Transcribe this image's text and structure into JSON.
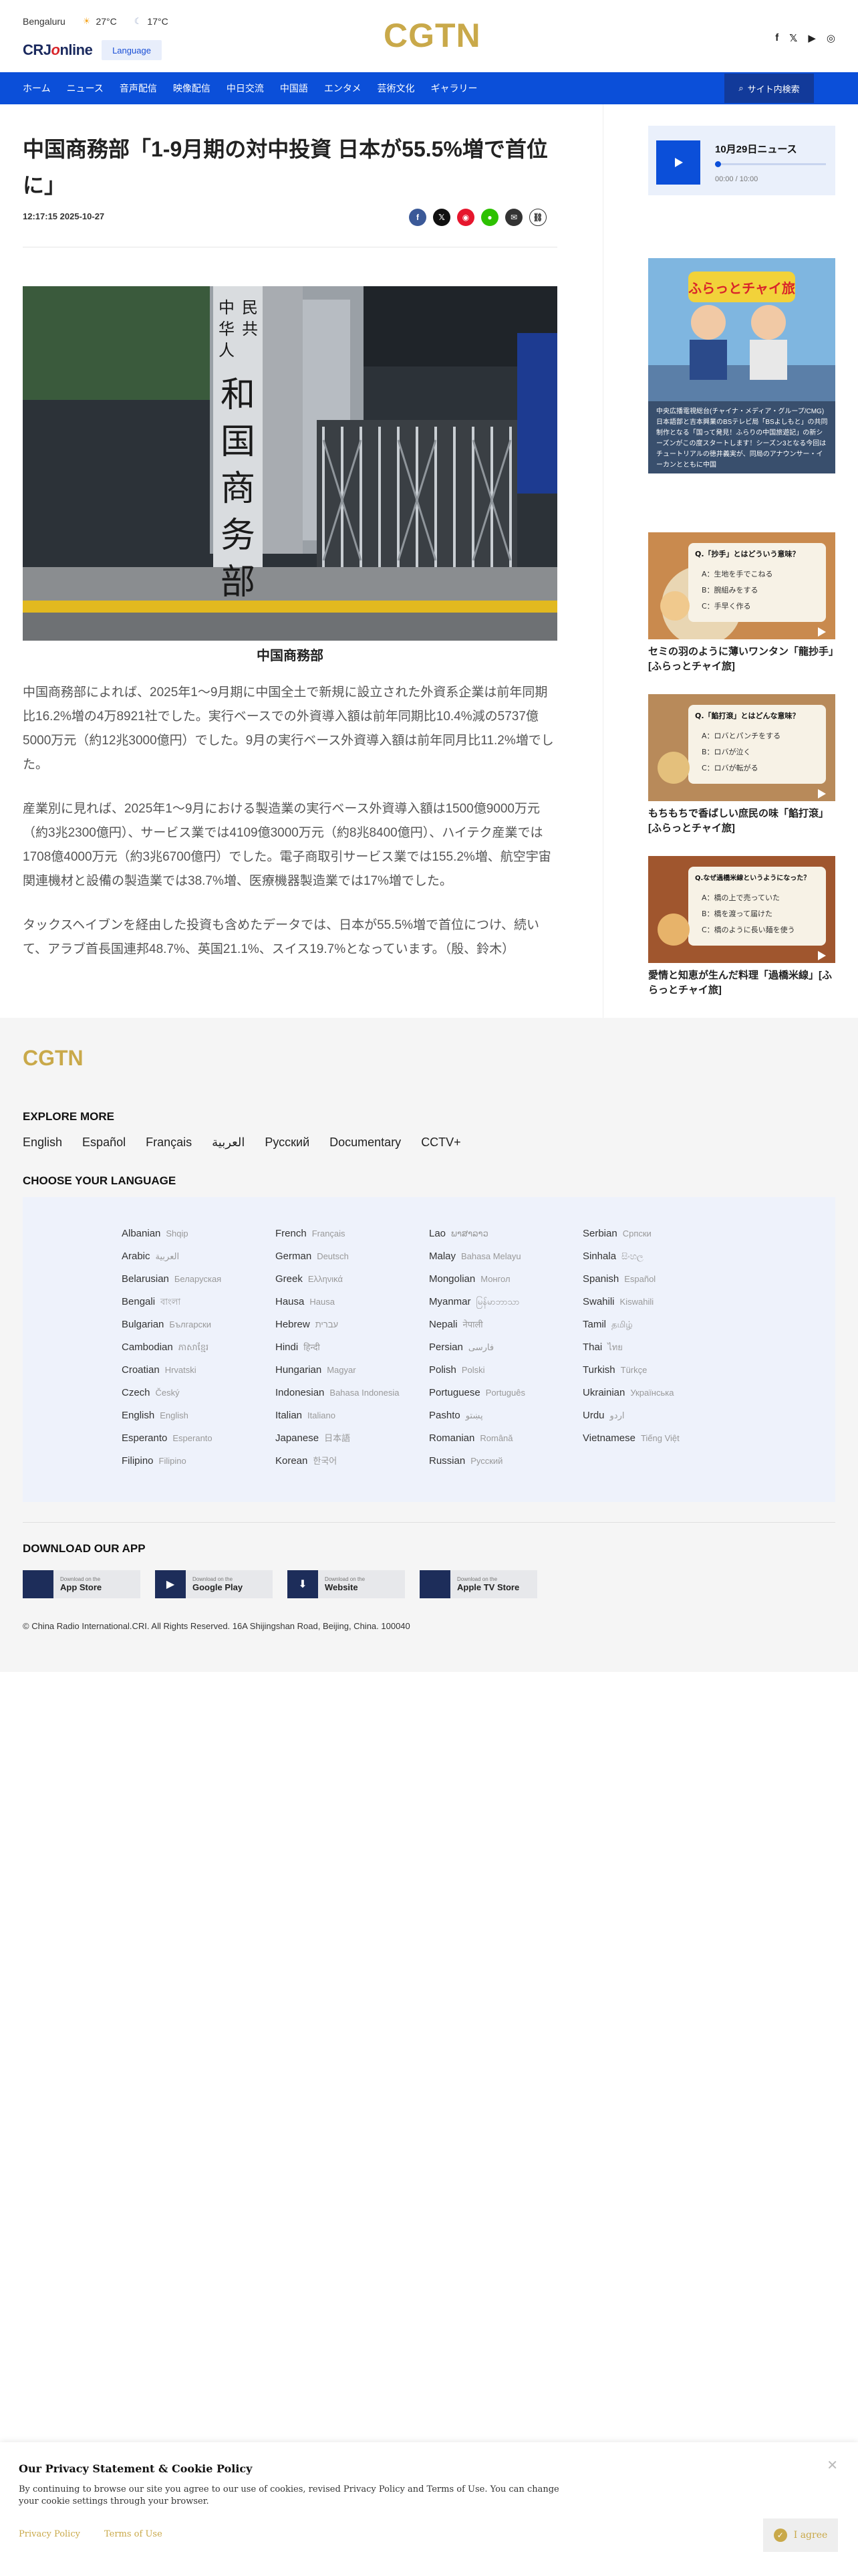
{
  "header": {
    "city": "Bengaluru",
    "temp_high": "27°C",
    "temp_low": "17°C",
    "crj_logo_a": "CRJ",
    "crj_logo_o": "o",
    "crj_logo_b": "nline",
    "language_label": "Language",
    "logo": "CGTN",
    "social": [
      "f",
      "𝕏",
      "▶",
      "◎"
    ]
  },
  "nav": {
    "items": [
      "ホーム",
      "ニュース",
      "音声配信",
      "映像配信",
      "中日交流",
      "中国語",
      "エンタメ",
      "芸術文化",
      "ギャラリー"
    ],
    "search_label": "サイト内検索"
  },
  "article": {
    "title": "中国商務部「1-9月期の対中投資 日本が55.5%増で首位に」",
    "datetime": "12:17:15 2025-10-27",
    "caption": "中国商務部",
    "sign_text": "中华人民共和国商务部",
    "paragraphs": [
      "中国商務部によれば、2025年1〜9月期に中国全土で新規に設立された外資系企業は前年同期比16.2%増の4万8921社でした。実行ベースでの外資導入額は前年同期比10.4%減の5737億5000万元（約12兆3000億円）でした。9月の実行ベース外資導入額は前年同月比11.2%増でした。",
      "産業別に見れば、2025年1〜9月における製造業の実行ベース外資導入額は1500億9000万元（約3兆2300億円）、サービス業では4109億3000万元（約8兆8400億円）、ハイテク産業では1708億4000万元（約3兆6700億円）でした。電子商取引サービス業では155.2%増、航空宇宙関連機材と設備の製造業では38.7%増、医療機器製造業では17%増でした。",
      "タックスヘイブンを経由した投資も含めたデータでは、日本が55.5%増で首位につけ、続いて、アラブ首長国連邦48.7%、英国21.1%、スイス19.7%となっています。（殷、鈴木）"
    ]
  },
  "sidebar": {
    "news_title": "10月29日ニュース",
    "news_time": "00:00 / 10:00",
    "ad_banner": "ふらっとチャイ旅",
    "ad_text": "中央広播電視総台(チャイナ・メディア・グループ/CMG)日本語部と吉本興業のBSテレビ局「BSよしもと」の共同制作となる「国って発見！ふらりの中国旅遊記」の新シーズンがこの度スタートします！シーズン3となる今回はチュートリアルの徳井義実が、同局のアナウンサー・イーカンとともに中国",
    "cards": [
      {
        "title": "セミの羽のように薄いワンタン「龍抄手」[ふらっとチャイ旅]",
        "quiz_q": "Q.「抄手」とはどういう意味？",
        "quiz_a": [
          "A：生地を手でこねる",
          "B：腕組みをする",
          "C：手早く作る"
        ]
      },
      {
        "title": "もちもちで香ばしい庶民の味「餡打滾」[ふらっとチャイ旅]",
        "quiz_q": "Q.「餡打滾」とはどんな意味？",
        "quiz_a": [
          "A：ロバとパンチをする",
          "B：ロバが泣く",
          "C：ロバが転がる"
        ]
      },
      {
        "title": "愛情と知恵が生んだ料理「過橋米線」[ふらっとチャイ旅]",
        "quiz_q": "Q.なぜ過橋米線というようになった？",
        "quiz_a": [
          "A：橋の上で売っていた",
          "B：橋を渡って届けた",
          "C：橋のように長い麺を使う"
        ]
      }
    ]
  },
  "footer": {
    "logo": "CGTN",
    "explore_heading": "EXPLORE MORE",
    "explore": [
      "English",
      "Español",
      "Français",
      "العربية",
      "Русский",
      "Documentary",
      "CCTV+"
    ],
    "choose_heading": "CHOOSE YOUR LANGUAGE",
    "languages": [
      [
        [
          "Albanian",
          "Shqip"
        ],
        [
          "Arabic",
          "العربية"
        ],
        [
          "Belarusian",
          "Беларуская"
        ],
        [
          "Bengali",
          "বাংলা"
        ],
        [
          "Bulgarian",
          "Български"
        ],
        [
          "Cambodian",
          "ភាសាខ្មែរ"
        ],
        [
          "Croatian",
          "Hrvatski"
        ],
        [
          "Czech",
          "Český"
        ],
        [
          "English",
          "English"
        ],
        [
          "Esperanto",
          "Esperanto"
        ],
        [
          "Filipino",
          "Filipino"
        ]
      ],
      [
        [
          "French",
          "Français"
        ],
        [
          "German",
          "Deutsch"
        ],
        [
          "Greek",
          "Ελληνικά"
        ],
        [
          "Hausa",
          "Hausa"
        ],
        [
          "Hebrew",
          "עברית"
        ],
        [
          "Hindi",
          "हिन्दी"
        ],
        [
          "Hungarian",
          "Magyar"
        ],
        [
          "Indonesian",
          "Bahasa Indonesia"
        ],
        [
          "Italian",
          "Italiano"
        ],
        [
          "Japanese",
          "日本語"
        ],
        [
          "Korean",
          "한국어"
        ]
      ],
      [
        [
          "Lao",
          "ພາສາລາວ"
        ],
        [
          "Malay",
          "Bahasa Melayu"
        ],
        [
          "Mongolian",
          "Монгол"
        ],
        [
          "Myanmar",
          "မြန်မာဘာသာ"
        ],
        [
          "Nepali",
          "नेपाली"
        ],
        [
          "Persian",
          "فارسی"
        ],
        [
          "Polish",
          "Polski"
        ],
        [
          "Portuguese",
          "Português"
        ],
        [
          "Pashto",
          "پښتو"
        ],
        [
          "Romanian",
          "Română"
        ],
        [
          "Russian",
          "Русский"
        ]
      ],
      [
        [
          "Serbian",
          "Српски"
        ],
        [
          "Sinhala",
          "සිංහල"
        ],
        [
          "Spanish",
          "Español"
        ],
        [
          "Swahili",
          "Kiswahili"
        ],
        [
          "Tamil",
          "தமிழ்"
        ],
        [
          "Thai",
          "ไทย"
        ],
        [
          "Turkish",
          "Türkçe"
        ],
        [
          "Ukrainian",
          "Українська"
        ],
        [
          "Urdu",
          "اردو"
        ],
        [
          "Vietnamese",
          "Tiếng Việt"
        ]
      ]
    ],
    "download_heading": "DOWNLOAD OUR APP",
    "apps": [
      {
        "small": "Download on the",
        "big": "App Store",
        "icon": ""
      },
      {
        "small": "Download on the",
        "big": "Google Play",
        "icon": "▶"
      },
      {
        "small": "Download on the",
        "big": "Website",
        "icon": "⬇"
      },
      {
        "small": "Download on the",
        "big": "Apple TV Store",
        "icon": ""
      }
    ],
    "copyright": "© China Radio International.CRI. All Rights Reserved. 16A Shijingshan Road, Beijing, China. 100040"
  },
  "cookie": {
    "heading": "Our Privacy Statement & Cookie Policy",
    "body": "By continuing to browse our site you agree to our use of cookies, revised Privacy Policy and Terms of Use. You can change your cookie settings through your browser.",
    "privacy_link": "Privacy Policy",
    "terms_link": "Terms of Use",
    "agree_label": "I agree"
  }
}
